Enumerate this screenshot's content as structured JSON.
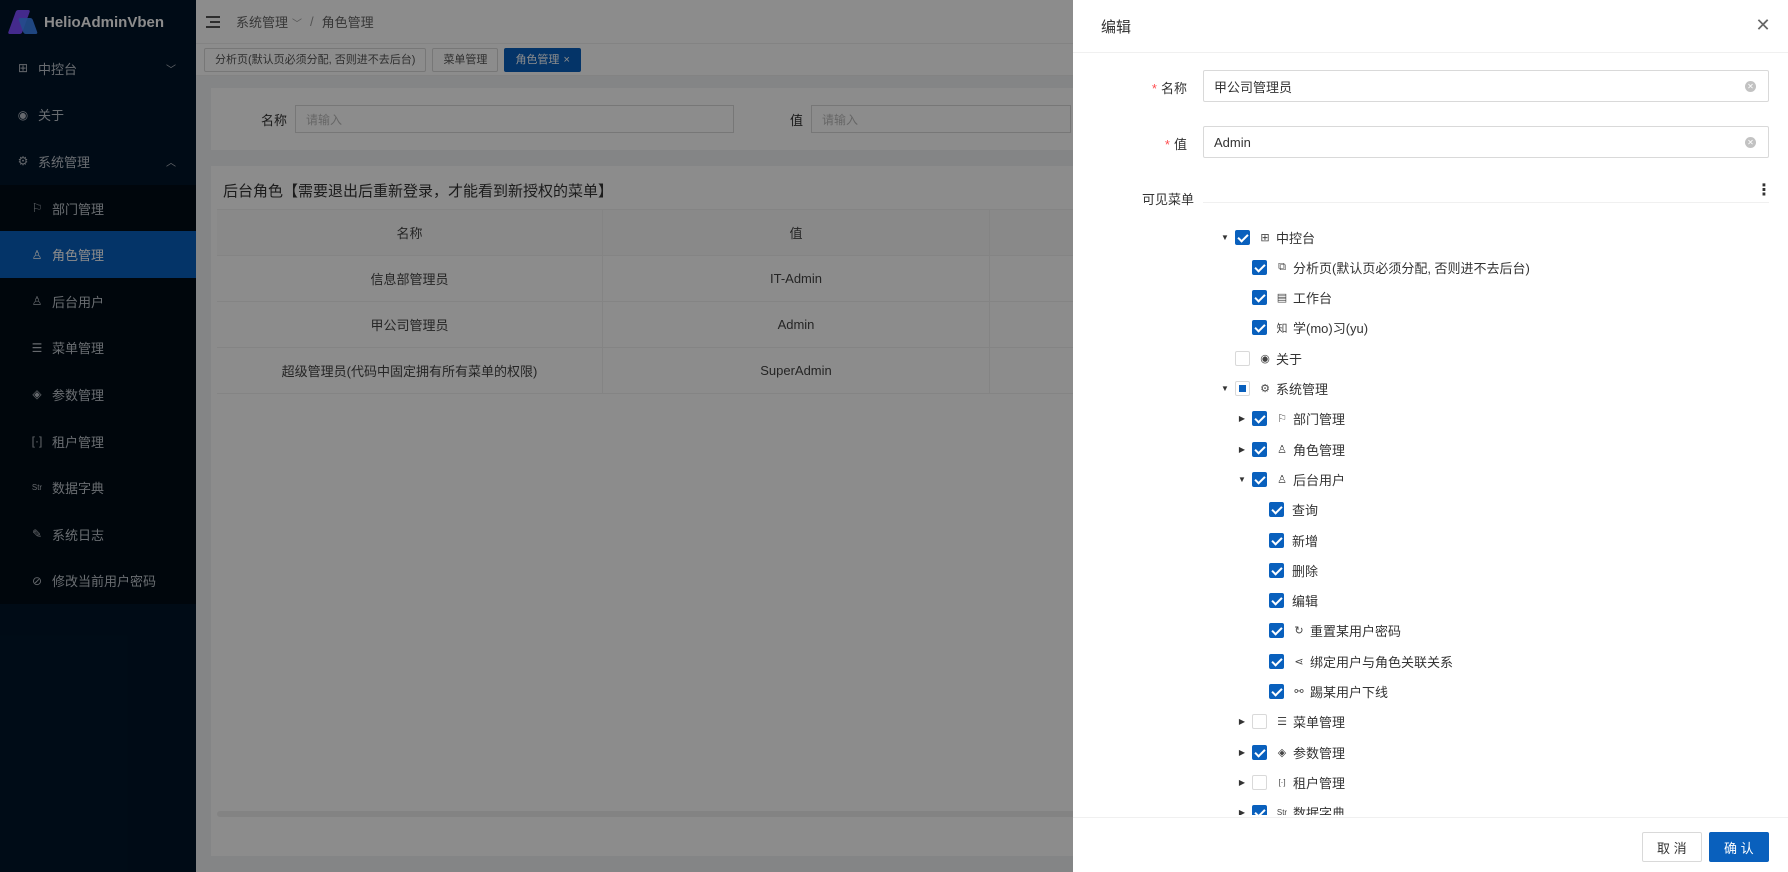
{
  "app": {
    "name": "HelioAdminVben"
  },
  "sidebar": {
    "items": [
      {
        "label": "中控台",
        "icon": "dashboard-icon"
      },
      {
        "label": "关于",
        "icon": "eye-icon"
      },
      {
        "label": "系统管理",
        "icon": "gear-icon"
      }
    ],
    "sub": [
      {
        "label": "部门管理",
        "icon": "flag-icon"
      },
      {
        "label": "角色管理",
        "icon": "role-icon"
      },
      {
        "label": "后台用户",
        "icon": "user-icon"
      },
      {
        "label": "菜单管理",
        "icon": "menu-icon"
      },
      {
        "label": "参数管理",
        "icon": "param-icon"
      },
      {
        "label": "租户管理",
        "icon": "tenant-icon"
      },
      {
        "label": "数据字典",
        "icon": "str-icon",
        "glyph": "Str"
      },
      {
        "label": "系统日志",
        "icon": "pen-icon"
      },
      {
        "label": "修改当前用户密码",
        "icon": "compass-icon"
      }
    ]
  },
  "breadcrumb": {
    "first": "系统管理",
    "sep": "/",
    "second": "角色管理"
  },
  "tabs": [
    {
      "label": "分析页(默认页必须分配, 否则进不去后台)"
    },
    {
      "label": "菜单管理"
    },
    {
      "label": "角色管理",
      "close": "×"
    }
  ],
  "search": {
    "name_label": "名称",
    "name_placeholder": "请输入",
    "value_label": "值",
    "value_placeholder": "请输入"
  },
  "table": {
    "title": "后台角色【需要退出后重新登录，才能看到新授权的菜单】",
    "headers": [
      "名称",
      "值",
      ""
    ],
    "rows": [
      [
        "信息部管理员",
        "IT-Admin"
      ],
      [
        "甲公司管理员",
        "Admin"
      ],
      [
        "超级管理员(代码中固定拥有所有菜单的权限)",
        "SuperAdmin"
      ]
    ]
  },
  "drawer": {
    "title": "编辑",
    "close": "✕",
    "name_label": "名称",
    "name_value": "甲公司管理员",
    "value_label": "值",
    "value_value": "Admin",
    "visible_menu_label": "可见菜单",
    "more": "⋮",
    "cancel": "取 消",
    "ok": "确 认"
  },
  "tree": [
    {
      "label": "中控台",
      "level": 0,
      "caret": "down",
      "check": "checked",
      "icon": "dashboard-icon",
      "glyph": "⊞"
    },
    {
      "label": "分析页(默认页必须分配, 否则进不去后台)",
      "level": 1,
      "caret": "none",
      "check": "checked",
      "icon": "chart-icon",
      "glyph": "⧉"
    },
    {
      "label": "工作台",
      "level": 1,
      "caret": "none",
      "check": "checked",
      "icon": "book-icon",
      "glyph": "▤"
    },
    {
      "label": "学(mo)习(yu)",
      "level": 1,
      "caret": "none",
      "check": "checked",
      "icon": "zhi-icon",
      "glyph": "知"
    },
    {
      "label": "关于",
      "level": 0,
      "caret": "none",
      "check": "none",
      "icon": "eye-icon",
      "glyph": "◉"
    },
    {
      "label": "系统管理",
      "level": 0,
      "caret": "down",
      "check": "half",
      "icon": "gear-icon",
      "glyph": "⚙"
    },
    {
      "label": "部门管理",
      "level": 1,
      "caret": "right",
      "check": "checked",
      "icon": "flag-icon",
      "glyph": "⚐"
    },
    {
      "label": "角色管理",
      "level": 1,
      "caret": "right",
      "check": "checked",
      "icon": "role-icon",
      "glyph": "♙"
    },
    {
      "label": "后台用户",
      "level": 1,
      "caret": "down",
      "check": "checked",
      "icon": "user-icon",
      "glyph": "♙"
    },
    {
      "label": "查询",
      "level": 2,
      "caret": "none",
      "check": "checked",
      "icon": "",
      "glyph": ""
    },
    {
      "label": "新增",
      "level": 2,
      "caret": "none",
      "check": "checked",
      "icon": "",
      "glyph": ""
    },
    {
      "label": "删除",
      "level": 2,
      "caret": "none",
      "check": "checked",
      "icon": "",
      "glyph": ""
    },
    {
      "label": "编辑",
      "level": 2,
      "caret": "none",
      "check": "checked",
      "icon": "",
      "glyph": ""
    },
    {
      "label": "重置某用户密码",
      "level": 2,
      "caret": "none",
      "check": "checked",
      "icon": "reset-icon",
      "glyph": "↻"
    },
    {
      "label": "绑定用户与角色关联关系",
      "level": 2,
      "caret": "none",
      "check": "checked",
      "icon": "share-icon",
      "glyph": "⋖"
    },
    {
      "label": "踢某用户下线",
      "level": 2,
      "caret": "none",
      "check": "checked",
      "icon": "link-icon",
      "glyph": "⚯"
    },
    {
      "label": "菜单管理",
      "level": 1,
      "caret": "right",
      "check": "none",
      "icon": "menu-icon",
      "glyph": "☰"
    },
    {
      "label": "参数管理",
      "level": 1,
      "caret": "right",
      "check": "checked",
      "icon": "param-icon",
      "glyph": "◈"
    },
    {
      "label": "租户管理",
      "level": 1,
      "caret": "right",
      "check": "none",
      "icon": "tenant-icon",
      "glyph": "[·]"
    },
    {
      "label": "数据字典",
      "level": 1,
      "caret": "right",
      "check": "checked",
      "icon": "str-icon",
      "glyph": "Str"
    }
  ]
}
